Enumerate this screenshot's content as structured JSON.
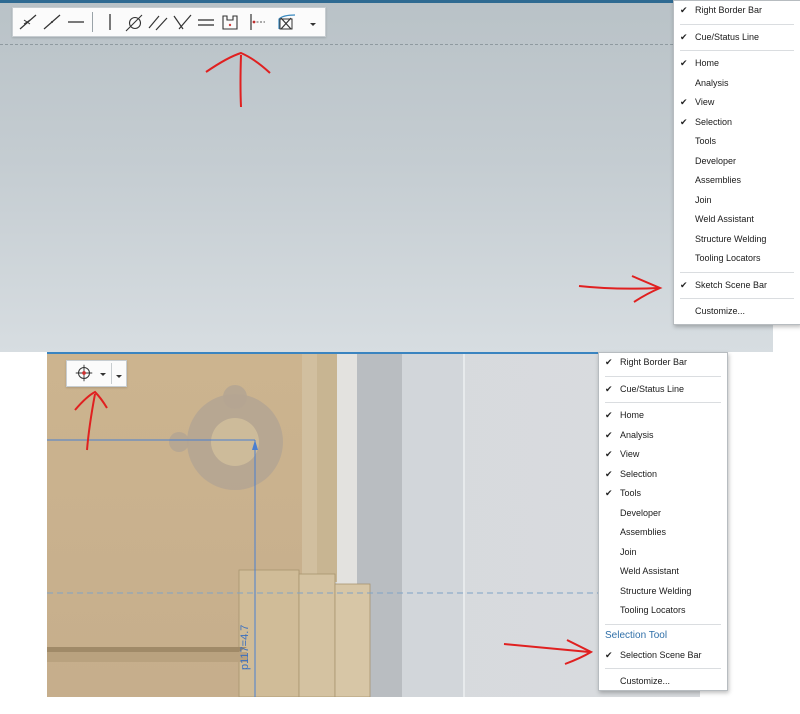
{
  "top_menu": {
    "sections": [
      [
        {
          "label": "Right Border Bar",
          "checked": true
        }
      ],
      [
        {
          "label": "Cue/Status Line",
          "checked": true
        }
      ],
      [
        {
          "label": "Home",
          "checked": true
        },
        {
          "label": "Analysis",
          "checked": false
        },
        {
          "label": "View",
          "checked": true
        },
        {
          "label": "Selection",
          "checked": true
        },
        {
          "label": "Tools",
          "checked": false
        },
        {
          "label": "Developer",
          "checked": false
        },
        {
          "label": "Assemblies",
          "checked": false
        },
        {
          "label": "Join",
          "checked": false
        },
        {
          "label": "Weld Assistant",
          "checked": false
        },
        {
          "label": "Structure Welding",
          "checked": false
        },
        {
          "label": "Tooling Locators",
          "checked": false
        }
      ],
      [
        {
          "label": "Sketch Scene Bar",
          "checked": true
        }
      ],
      [
        {
          "label": "Customize...",
          "checked": false
        }
      ]
    ]
  },
  "bottom_menu": {
    "sections": [
      [
        {
          "label": "Right Border Bar",
          "checked": true
        }
      ],
      [
        {
          "label": "Cue/Status Line",
          "checked": true
        }
      ],
      [
        {
          "label": "Home",
          "checked": true
        },
        {
          "label": "Analysis",
          "checked": true
        },
        {
          "label": "View",
          "checked": true
        },
        {
          "label": "Selection",
          "checked": true
        },
        {
          "label": "Tools",
          "checked": true
        },
        {
          "label": "Developer",
          "checked": false
        },
        {
          "label": "Assemblies",
          "checked": false
        },
        {
          "label": "Join",
          "checked": false
        },
        {
          "label": "Weld Assistant",
          "checked": false
        },
        {
          "label": "Structure Welding",
          "checked": false
        },
        {
          "label": "Tooling Locators",
          "checked": false
        }
      ],
      [
        {
          "label": "Selection Scene Bar",
          "checked": true
        }
      ],
      [
        {
          "label": "Customize...",
          "checked": false
        }
      ]
    ],
    "section_title": "Selection Tool"
  },
  "sketch_toolbar": {
    "icons": [
      "point-on-line-icon",
      "line-through-point-icon",
      "horizontal-line-icon",
      "vertical-line-icon",
      "tangent-circle-icon",
      "parallel-lines-icon",
      "perpendicular-lines-icon",
      "equal-length-icon",
      "midpoint-box-icon",
      "point-on-curve-icon",
      "constraint-symmetry-icon"
    ],
    "has_dropdown": true
  },
  "selection_toolbar": {
    "icon": "crosshair-target-icon",
    "has_dropdown": true
  },
  "dimension_label": "p117=4.7",
  "check_glyph": "✔",
  "colors": {
    "accent_blue": "#2f6a92",
    "annotation_red": "#e02020",
    "model_tan": "#c9b28f",
    "menu_title": "#2f6fa8"
  }
}
